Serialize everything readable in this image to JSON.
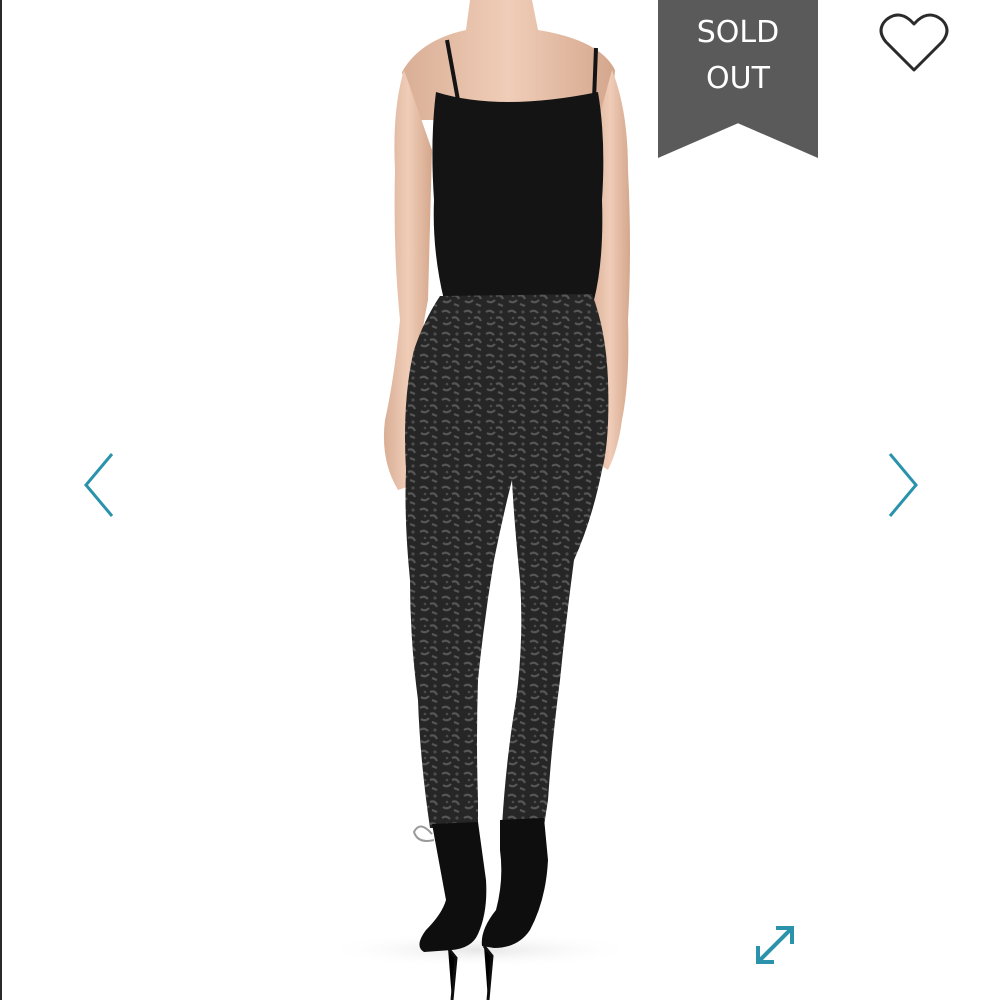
{
  "viewer": {
    "status_badge": {
      "line1": "SOLD",
      "line2": "OUT",
      "bg_color": "#5a5a5a"
    },
    "icons": {
      "wishlist": "heart-outline-icon",
      "previous": "chevron-left-icon",
      "next": "chevron-right-icon",
      "expand": "expand-diagonal-icon"
    },
    "accent_color": "#2a93ab"
  }
}
